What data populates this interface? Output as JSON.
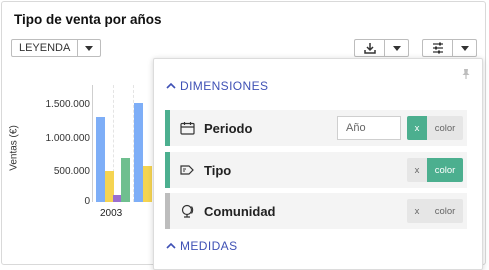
{
  "title": "Tipo de venta por años",
  "toolbar": {
    "legend_label": "LEYENDA",
    "download_icon": "download-icon",
    "settings_icon": "sliders-icon"
  },
  "chart_data": {
    "type": "bar",
    "categories": [
      "2003"
    ],
    "ylabel": "Ventas (€)",
    "yticks": [
      "1.500.000",
      "1.000.000",
      "500.000",
      "0"
    ],
    "ylim": [
      0,
      1800000
    ],
    "series": [
      {
        "values": [
          1300000
        ],
        "color": "#7eaef7"
      },
      {
        "values": [
          480000
        ],
        "color": "#f5d451"
      },
      {
        "values": [
          110000
        ],
        "color": "#9a6fcf"
      },
      {
        "values": [
          680000
        ],
        "color": "#6fbf8f"
      },
      {
        "values": [
          1520000
        ],
        "color": "#7eaef7"
      },
      {
        "values": [
          560000
        ],
        "color": "#f5d451"
      }
    ]
  },
  "panel": {
    "dimensions_header": "DIMENSIONES",
    "measures_header": "MEDIDAS",
    "rows": [
      {
        "label": "Periodo",
        "input": "Año",
        "x": "x",
        "color": "color",
        "active": "x",
        "icon": "calendar-icon"
      },
      {
        "label": "Tipo",
        "x": "x",
        "color": "color",
        "active": "color",
        "icon": "tag-icon"
      },
      {
        "label": "Comunidad",
        "x": "x",
        "color": "color",
        "active": "none",
        "icon": "globe-icon"
      }
    ]
  },
  "colors": {
    "accent": "#4caf8f",
    "header": "#3f51b5"
  }
}
